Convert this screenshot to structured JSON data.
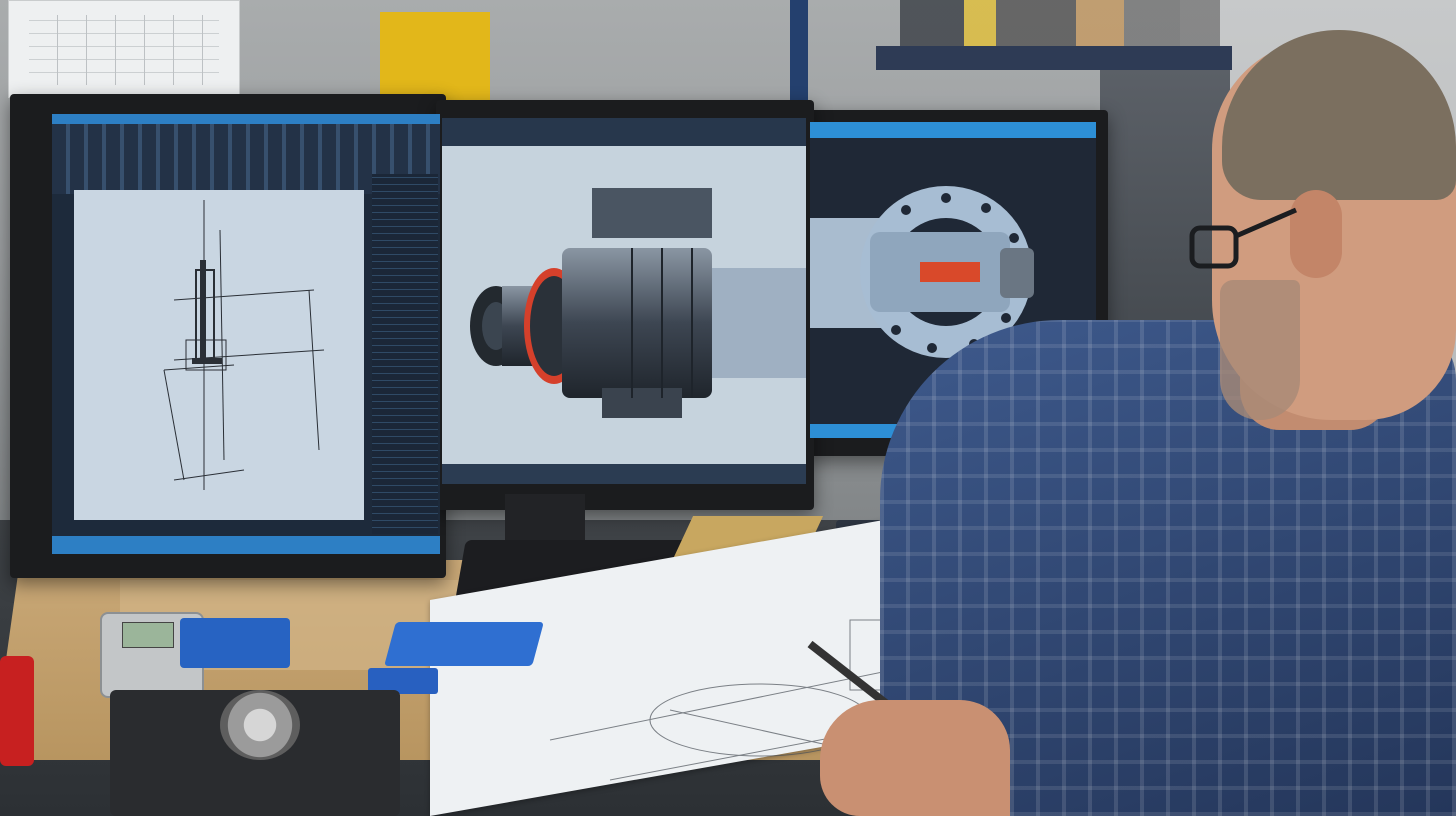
{
  "scene": {
    "description_type": "photo",
    "colors": {
      "screen_blue": "#2d7fc4",
      "cad_part": "#4a5562",
      "cad_accent": "#d9492a",
      "shirt_plaid": "#3e5a8d",
      "desk_wood": "#c9a877"
    }
  },
  "left_monitor": {
    "tab_label": ""
  },
  "icons": [
    "cad-drawing",
    "cad-3d-model",
    "disc-brake-model"
  ]
}
